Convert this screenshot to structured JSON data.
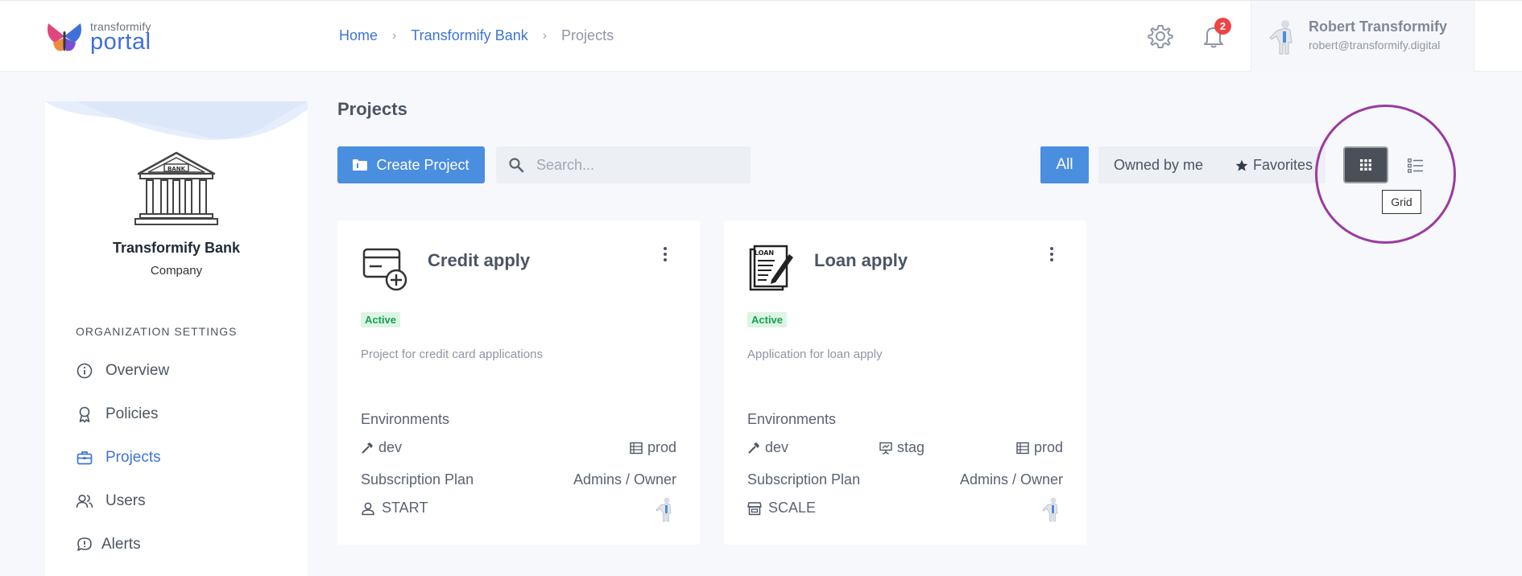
{
  "header": {
    "logo_small": "transformify",
    "logo_big": "portal",
    "breadcrumb": [
      "Home",
      "Transformify Bank",
      "Projects"
    ],
    "notifications_count": "2",
    "user_name": "Robert Transformify",
    "user_email": "robert@transformify.digital"
  },
  "sidebar": {
    "org_name": "Transformify Bank",
    "org_type": "Company",
    "bank_sign": "BANK",
    "section_title": "ORGANIZATION SETTINGS",
    "items": [
      {
        "label": "Overview",
        "icon": "info-icon"
      },
      {
        "label": "Policies",
        "icon": "ribbon-icon"
      },
      {
        "label": "Projects",
        "icon": "briefcase-icon",
        "active": true
      },
      {
        "label": "Users",
        "icon": "users-icon"
      },
      {
        "label": "Alerts",
        "icon": "alert-bubble-icon"
      }
    ]
  },
  "main": {
    "title": "Projects",
    "create_label": "Create Project",
    "search_placeholder": "Search...",
    "filters": {
      "all": "All",
      "owned": "Owned by me",
      "favorites": "Favorites"
    },
    "tooltip": "Grid",
    "accent_color": "#4a8ee0",
    "cards": [
      {
        "title": "Credit apply",
        "status": "Active",
        "description": "Project for credit card applications",
        "environments_label": "Environments",
        "environments": [
          "dev",
          "prod"
        ],
        "subscription_label": "Subscription Plan",
        "admins_label": "Admins / Owner",
        "plan": "START"
      },
      {
        "title": "Loan apply",
        "status": "Active",
        "description": "Application for loan apply",
        "environments_label": "Environments",
        "environments": [
          "dev",
          "stag",
          "prod"
        ],
        "subscription_label": "Subscription Plan",
        "admins_label": "Admins / Owner",
        "plan": "SCALE",
        "icon_text": "LOAN"
      }
    ]
  }
}
